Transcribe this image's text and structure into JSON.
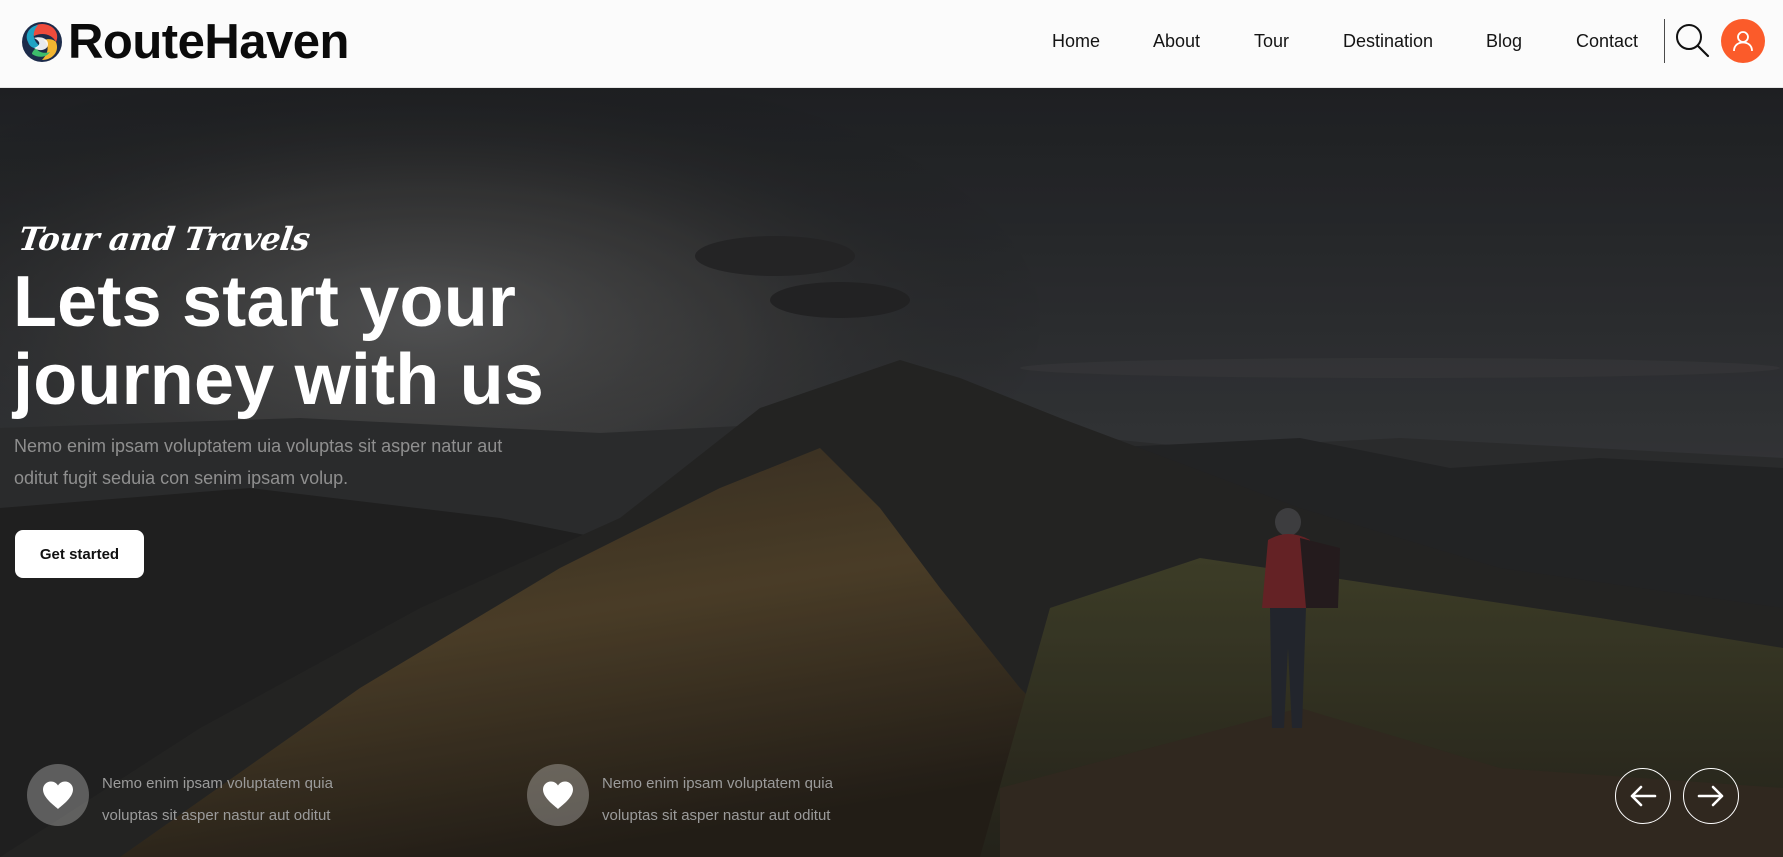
{
  "brand": {
    "name": "RouteHaven",
    "logo_icon": "swirl-logo-icon"
  },
  "nav": {
    "items": [
      {
        "label": "Home"
      },
      {
        "label": "About"
      },
      {
        "label": "Tour"
      },
      {
        "label": "Destination"
      },
      {
        "label": "Blog"
      },
      {
        "label": "Contact"
      }
    ],
    "search_icon": "search-icon",
    "profile_icon": "user-icon"
  },
  "hero": {
    "eyebrow": "Tour and Travels",
    "title_line1": "Lets start your",
    "title_line2": "journey with us",
    "description": "Nemo enim ipsam voluptatem uia voluptas sit asper natur aut oditut fugit seduia con senim ipsam volup.",
    "cta_label": "Get started"
  },
  "features": [
    {
      "icon": "heart-icon",
      "text": "Nemo enim ipsam voluptatem quia voluptas sit asper nastur aut oditut"
    },
    {
      "icon": "heart-icon",
      "text": "Nemo enim ipsam voluptatem quia voluptas sit asper nastur aut oditut"
    }
  ],
  "carousel": {
    "prev_icon": "arrow-left-icon",
    "next_icon": "arrow-right-icon"
  },
  "colors": {
    "accent": "#fb5b2a",
    "header_bg": "#fbfbfb",
    "hero_overlay": "#1f2022"
  }
}
